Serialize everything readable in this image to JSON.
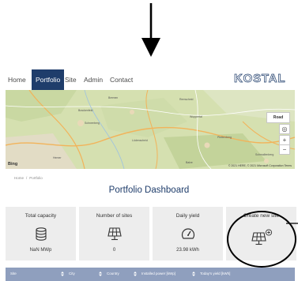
{
  "nav": {
    "items": [
      {
        "label": "Home"
      },
      {
        "label": "Portfolio",
        "active": true
      },
      {
        "label": "Site"
      },
      {
        "label": "Admin"
      },
      {
        "label": "Contact"
      }
    ],
    "logo": "KOSTAL"
  },
  "map": {
    "road_button": "Road",
    "brand": "Bing",
    "copyright": "© 2021 HERE, © 2021 Microsoft Corporation  Terms",
    "place_labels": [
      "Brackenfeld",
      "Bremen",
      "Remscheid",
      "Schneeberg",
      "Lüdenscheid",
      "Wuppertal",
      "Plettenberg",
      "Schmallenberg",
      "Hemer",
      "Balve"
    ],
    "controls": {
      "locate": "◎",
      "zoom_in": "+",
      "zoom_out": "−"
    }
  },
  "breadcrumb": {
    "home": "Home",
    "separator": "/",
    "current": "Portfolio"
  },
  "page_title": "Portfolio Dashboard",
  "cards": [
    {
      "title": "Total capacity",
      "value": "NaN MWp",
      "icon": "database-icon"
    },
    {
      "title": "Number of sites",
      "value": "0",
      "icon": "solar-panel-icon"
    },
    {
      "title": "Daily yield",
      "value": "23.98 kWh",
      "icon": "gauge-icon"
    },
    {
      "title": "Create new site",
      "value": "",
      "icon": "solar-panel-add-icon"
    }
  ],
  "table": {
    "headers": [
      "Site",
      "City",
      "Country",
      "Installed power [kWp]",
      "Today's yield [kWh]"
    ]
  },
  "colors": {
    "brand": "#1f3d6b",
    "table_header": "#8f9fbe",
    "card_bg": "#ededed"
  }
}
